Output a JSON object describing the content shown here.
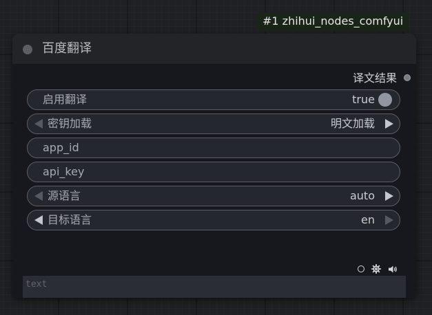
{
  "badge": {
    "text": "#1 zhihui_nodes_comfyui"
  },
  "node": {
    "title": "百度翻译",
    "output": {
      "label": "译文结果"
    },
    "widgets": [
      {
        "kind": "toggle",
        "label": "启用翻译",
        "value": "true"
      },
      {
        "kind": "combo",
        "label": "密钥加载",
        "value": "明文加载",
        "left_arrow_enabled": false,
        "right_arrow_enabled": true
      },
      {
        "kind": "text",
        "label": "app_id"
      },
      {
        "kind": "text",
        "label": "api_key"
      },
      {
        "kind": "combo",
        "label": "源语言",
        "value": "auto",
        "left_arrow_enabled": false,
        "right_arrow_enabled": true
      },
      {
        "kind": "combo",
        "label": "目标语言",
        "value": "en",
        "left_arrow_enabled": true,
        "right_arrow_enabled": false
      }
    ],
    "text_input": {
      "placeholder": "text",
      "value": ""
    },
    "icons": [
      "circle-icon",
      "gear-icon",
      "speaker-icon"
    ]
  },
  "colors": {
    "canvas": "#1f2023",
    "node_body": "#16181d",
    "widget_bg": "#25272e",
    "widget_border": "#5b5e66",
    "badge_bg": "#1a2519"
  }
}
